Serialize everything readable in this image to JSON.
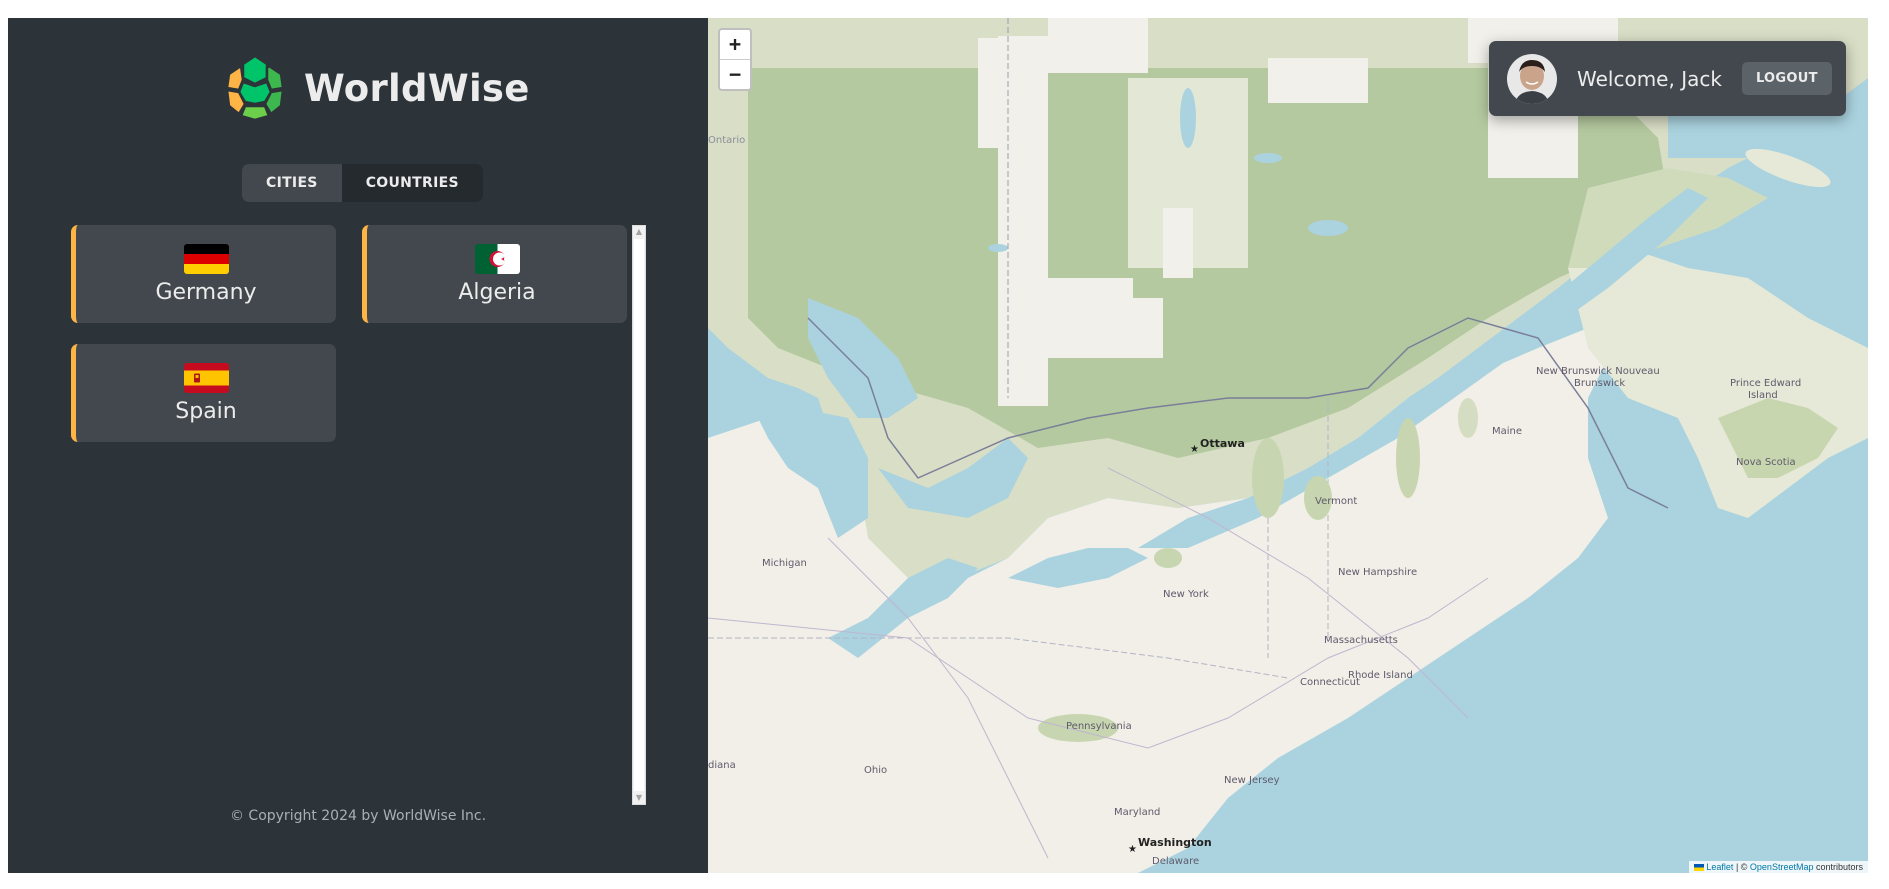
{
  "app": {
    "name": "WorldWise"
  },
  "tabs": [
    {
      "label": "CITIES",
      "active": false
    },
    {
      "label": "COUNTRIES",
      "active": true
    }
  ],
  "countries": [
    {
      "emoji": "🇩🇪",
      "name": "Germany"
    },
    {
      "emoji": "🇩🇿",
      "name": "Algeria"
    },
    {
      "emoji": "🇪🇸",
      "name": "Spain"
    }
  ],
  "footer": {
    "copyright": "© Copyright 2024 by WorldWise Inc."
  },
  "map": {
    "zoom_in": "+",
    "zoom_out": "−",
    "labels": {
      "ontario": "Ontario",
      "ottawa": "Ottawa",
      "michigan": "Michigan",
      "new_york": "New York",
      "vermont": "Vermont",
      "new_hampshire": "New Hampshire",
      "maine": "Maine",
      "massachusetts": "Massachusetts",
      "connecticut": "Connecticut",
      "rhode_island": "Rhode Island",
      "pennsylvania": "Pennsylvania",
      "ohio": "Ohio",
      "indiana": "diana",
      "new_jersey": "New Jersey",
      "maryland": "Maryland",
      "washington": "Washington",
      "delaware": "Delaware",
      "new_brunswick": "New Brunswick Nouveau",
      "new_brunswick_2": "Brunswick",
      "pei": "Prince Edward",
      "pei_2": "Island",
      "nova_scotia": "Nova Scotia"
    },
    "attribution": {
      "leaflet": "Leaflet",
      "separator": " | © ",
      "osm": "OpenStreetMap",
      "suffix": " contributors"
    }
  },
  "user": {
    "welcome": "Welcome, Jack",
    "logout": "LOGOUT"
  },
  "colors": {
    "accent": "#ffb545",
    "brand_green": "#00c46a",
    "sidebar_bg": "#2d3439",
    "card_bg": "#42484d"
  }
}
